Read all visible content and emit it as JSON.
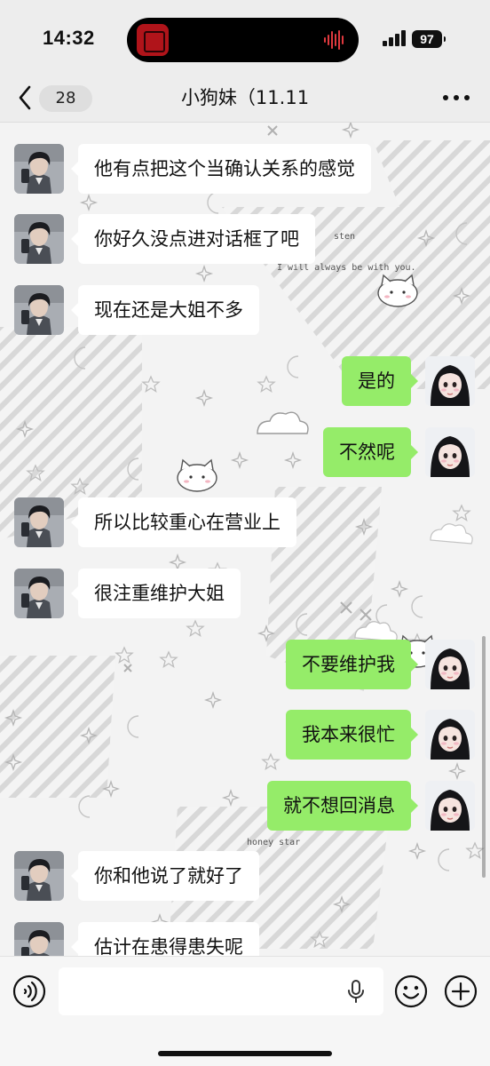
{
  "status_bar": {
    "time": "14:32",
    "battery": "97",
    "icons": [
      "signal-icon",
      "wifi-icon",
      "battery-icon",
      "now-playing-icon"
    ]
  },
  "nav": {
    "back_badge": "28",
    "title": "小狗妹（11.11",
    "icons": [
      "back-chevron-icon",
      "more-dots-icon"
    ]
  },
  "messages": [
    {
      "side": "in",
      "text": "他有点把这个当确认关系的感觉"
    },
    {
      "side": "in",
      "text": "你好久没点进对话框了吧"
    },
    {
      "side": "in",
      "text": "现在还是大姐不多"
    },
    {
      "side": "out",
      "text": "是的"
    },
    {
      "side": "out",
      "text": "不然呢"
    },
    {
      "side": "in",
      "text": "所以比较重心在营业上"
    },
    {
      "side": "in",
      "text": "很注重维护大姐"
    },
    {
      "side": "out",
      "text": "不要维护我"
    },
    {
      "side": "out",
      "text": "我本来很忙"
    },
    {
      "side": "out",
      "text": "就不想回消息"
    },
    {
      "side": "in",
      "text": "你和他说了就好了"
    },
    {
      "side": "in",
      "text": "估计在患得患失呢"
    }
  ],
  "wallpaper_text": [
    "sten",
    "I will always be with you.",
    "honey star"
  ],
  "input_bar": {
    "message_value": "",
    "icons": [
      "voice-icon",
      "mic-icon",
      "emoji-icon",
      "plus-icon"
    ]
  },
  "colors": {
    "outgoing_bubble": "#95ec69",
    "incoming_bubble": "#ffffff",
    "bar_background": "#ededed"
  }
}
